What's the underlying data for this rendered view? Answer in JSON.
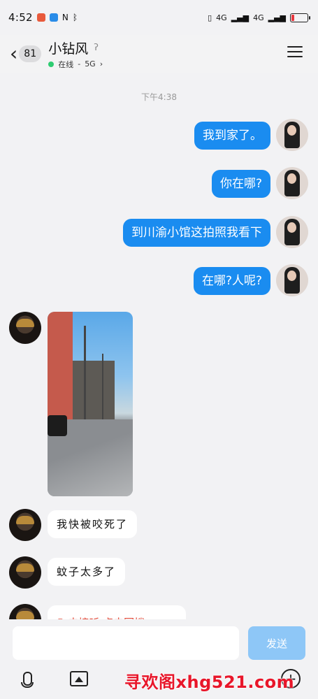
{
  "status_bar": {
    "time": "4:52",
    "network": "4G",
    "network2": "4G"
  },
  "header": {
    "back_icon": "chevron-left-icon",
    "unread_count": "81",
    "contact_name": "小钻风",
    "ear_icon": "ear-icon",
    "online_status": "在线",
    "network_status": "5G",
    "status_color": "#2ecc71"
  },
  "messages": {
    "timestamp": "下午4:38",
    "outgoing": [
      "我到家了。",
      "你在哪?",
      "到川渝小馆这拍照我看下",
      "在哪?人呢?"
    ],
    "incoming": [
      "我快被咬死了",
      "蚊子太多了"
    ],
    "call_notice": "未接听,点击回拨"
  },
  "composer": {
    "input_placeholder": "",
    "send_label": "发送",
    "send_color": "#8ec7f7"
  },
  "watermark": "寻欢阁xhg521.com",
  "colors": {
    "outgoing_bubble": "#1a8cf0",
    "incoming_bubble": "#ffffff",
    "background": "#f2f2f4"
  }
}
